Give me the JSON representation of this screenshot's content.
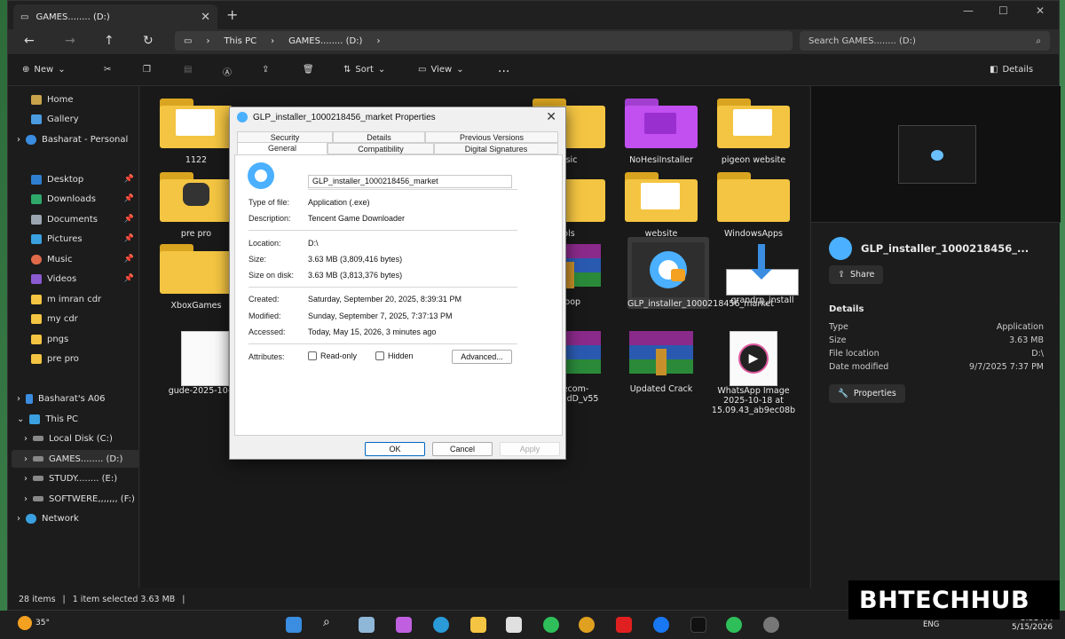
{
  "window": {
    "tab_title": "GAMES........ (D:)",
    "nav_path": [
      "This PC",
      "GAMES........ (D:)"
    ],
    "search_placeholder": "Search GAMES........ (D:)"
  },
  "toolbar": {
    "new_label": "New",
    "sort_label": "Sort",
    "view_label": "View",
    "more_label": "...",
    "details_label": "Details"
  },
  "sidebar": {
    "items": [
      {
        "label": "Home"
      },
      {
        "label": "Gallery"
      },
      {
        "label": "Basharat - Personal"
      },
      {
        "label": "Desktop"
      },
      {
        "label": "Downloads"
      },
      {
        "label": "Documents"
      },
      {
        "label": "Pictures"
      },
      {
        "label": "Music"
      },
      {
        "label": "Videos"
      },
      {
        "label": "m imran cdr"
      },
      {
        "label": "my cdr"
      },
      {
        "label": "pngs"
      },
      {
        "label": "pre pro"
      },
      {
        "label": "Basharat's A06"
      },
      {
        "label": "This PC"
      },
      {
        "label": "Local Disk (C:)"
      },
      {
        "label": "GAMES........ (D:)"
      },
      {
        "label": "STUDY........ (E:)"
      },
      {
        "label": "SOFTWERE,,,,,,, (F:)"
      },
      {
        "label": "Network"
      }
    ]
  },
  "files": [
    {
      "label": "1122"
    },
    {
      "label": "usic"
    },
    {
      "label": "NoHesiInstaller"
    },
    {
      "label": "pigeon website"
    },
    {
      "label": "pre pro"
    },
    {
      "label": "ols"
    },
    {
      "label": "website"
    },
    {
      "label": "WindowsApps"
    },
    {
      "label": "XboxGames"
    },
    {
      "label": "eloop"
    },
    {
      "label": "GLP_installer_1000218456_market"
    },
    {
      "label": "grandrp_install"
    },
    {
      "label": "gude-2025-10-19"
    },
    {
      "label": "nctecom-rontendD_v55"
    },
    {
      "label": "Updated Crack"
    },
    {
      "label": "WhatsApp Image 2025-10-18 at 15.09.43_ab9ec08b"
    }
  ],
  "details_pane": {
    "file_name": "GLP_installer_1000218456_...",
    "share_label": "Share",
    "section_title": "Details",
    "rows": [
      {
        "key": "Type",
        "value": "Application"
      },
      {
        "key": "Size",
        "value": "3.63 MB"
      },
      {
        "key": "File location",
        "value": "D:\\"
      },
      {
        "key": "Date modified",
        "value": "9/7/2025 7:37 PM"
      }
    ],
    "properties_label": "Properties"
  },
  "statusbar": {
    "items_count": "28 items",
    "selection": "1 item selected  3.63 MB"
  },
  "dialog": {
    "title": "GLP_installer_1000218456_market Properties",
    "tabs_row1": [
      "Security",
      "Details",
      "Previous Versions"
    ],
    "tabs_row2": [
      "General",
      "Compatibility",
      "Digital Signatures"
    ],
    "name_value": "GLP_installer_1000218456_market",
    "fields": [
      {
        "key": "Type of file:",
        "value": "Application (.exe)"
      },
      {
        "key": "Description:",
        "value": "Tencent Game Downloader"
      },
      {
        "key": "Location:",
        "value": "D:\\"
      },
      {
        "key": "Size:",
        "value": "3.63 MB (3,809,416 bytes)"
      },
      {
        "key": "Size on disk:",
        "value": "3.63 MB (3,813,376 bytes)"
      },
      {
        "key": "Created:",
        "value": "Saturday, September 20, 2025, 8:39:31 PM"
      },
      {
        "key": "Modified:",
        "value": "Sunday, September 7, 2025, 7:37:13 PM"
      },
      {
        "key": "Accessed:",
        "value": "Today, May 15, 2026, 3 minutes ago"
      }
    ],
    "attributes_label": "Attributes:",
    "readonly_label": "Read-only",
    "hidden_label": "Hidden",
    "advanced_label": "Advanced...",
    "ok_label": "OK",
    "cancel_label": "Cancel",
    "apply_label": "Apply"
  },
  "taskbar": {
    "weather": "35°",
    "lang": "ENG",
    "time": "3:31 PM",
    "date": "5/15/2026"
  },
  "watermark": "BHTECHHUB"
}
